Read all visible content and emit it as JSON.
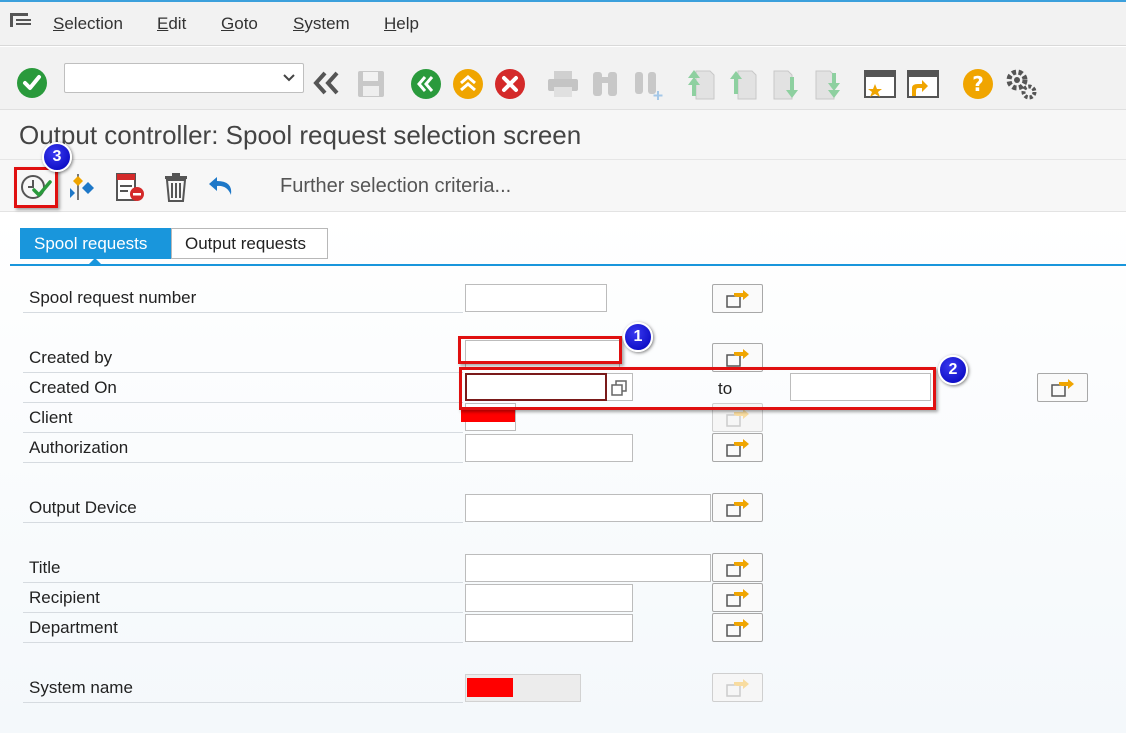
{
  "menu": {
    "items": [
      {
        "label": "Selection"
      },
      {
        "label": "Edit"
      },
      {
        "label": "Goto"
      },
      {
        "label": "System"
      },
      {
        "label": "Help"
      }
    ]
  },
  "toolbar": {
    "command_field": {
      "value": "",
      "placeholder": ""
    }
  },
  "page": {
    "title": "Output controller: Spool request selection screen"
  },
  "app_toolbar": {
    "further_selection": "Further selection criteria..."
  },
  "tabs": [
    {
      "label": "Spool requests",
      "active": true
    },
    {
      "label": "Output requests",
      "active": false
    }
  ],
  "form": {
    "spool_request_number": {
      "label": "Spool request number",
      "value": ""
    },
    "created_by": {
      "label": "Created by",
      "value": ""
    },
    "created_on": {
      "label": "Created On",
      "from": "",
      "to_label": "to",
      "to": ""
    },
    "client": {
      "label": "Client"
    },
    "authorization": {
      "label": "Authorization",
      "value": ""
    },
    "output_device": {
      "label": "Output Device",
      "value": ""
    },
    "title": {
      "label": "Title",
      "value": ""
    },
    "recipient": {
      "label": "Recipient",
      "value": ""
    },
    "department": {
      "label": "Department",
      "value": ""
    },
    "system_name": {
      "label": "System name"
    }
  },
  "annotations": {
    "badge1": "1",
    "badge2": "2",
    "badge3": "3"
  },
  "colors": {
    "accent": "#1996dc",
    "highlight": "#e01010",
    "badge": "#0000c8",
    "redacted": "#ff0000"
  }
}
